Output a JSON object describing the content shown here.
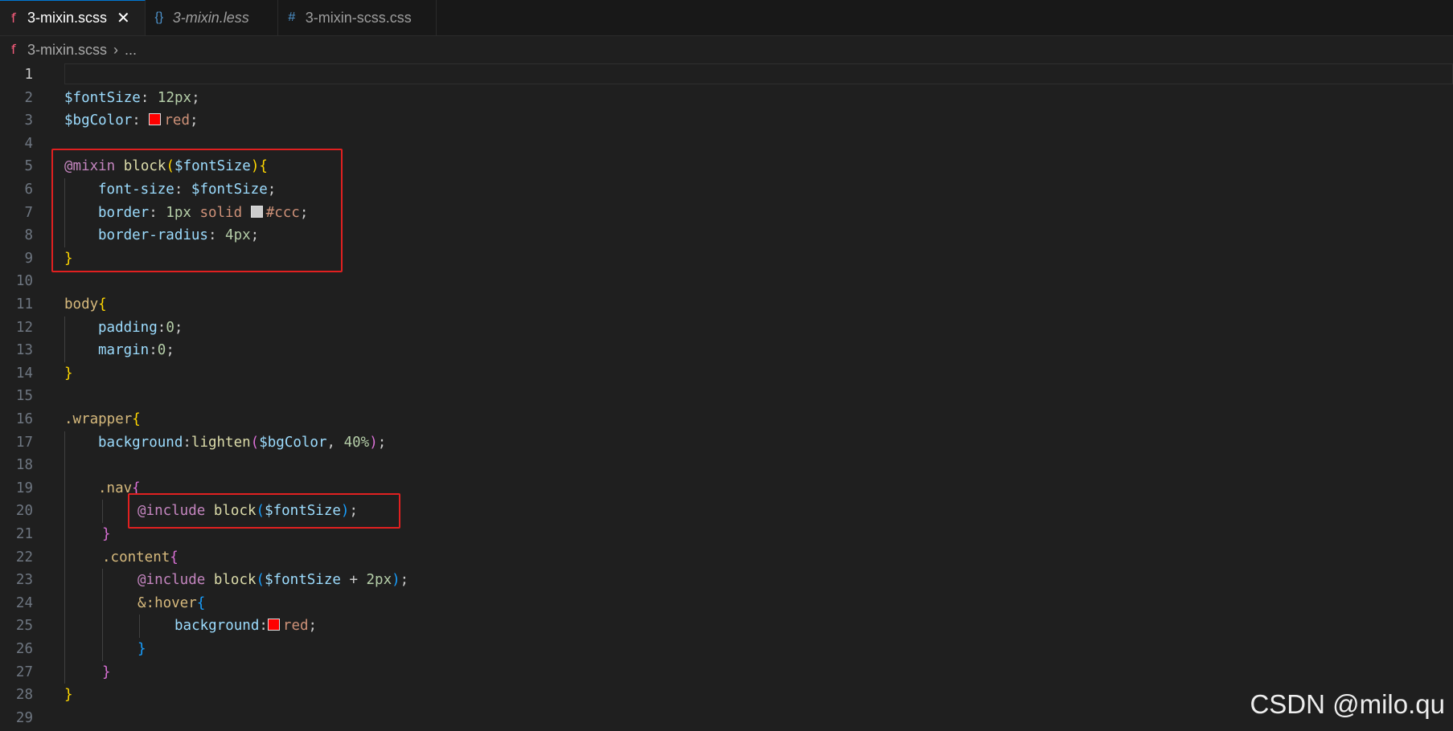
{
  "tabs": [
    {
      "label": "3-mixin.scss",
      "icon": "sass-icon",
      "active": true,
      "close": "✕"
    },
    {
      "label": "3-mixin.less",
      "icon": "braces-icon",
      "active": false
    },
    {
      "label": "3-mixin-scss.css",
      "icon": "hash-icon",
      "active": false
    }
  ],
  "icons": {
    "sass": "ẝ",
    "braces": "{}",
    "hash": "#"
  },
  "breadcrumb": {
    "file": "3-mixin.scss",
    "separator": "›",
    "more": "..."
  },
  "line_numbers": [
    "1",
    "2",
    "3",
    "4",
    "5",
    "6",
    "7",
    "8",
    "9",
    "10",
    "11",
    "12",
    "13",
    "14",
    "15",
    "16",
    "17",
    "18",
    "19",
    "20",
    "21",
    "22",
    "23",
    "24",
    "25",
    "26",
    "27",
    "28",
    "29"
  ],
  "colors": {
    "red": "#ff0000",
    "ccc": "#cccccc",
    "highlight": "#e02020"
  },
  "code": {
    "l2": {
      "var": "$fontSize",
      "colon": ": ",
      "val": "12px",
      "end": ";"
    },
    "l3": {
      "var": "$bgColor",
      "colon": ": ",
      "val": "red",
      "end": ";"
    },
    "l5": {
      "kw": "@mixin",
      "sp": " ",
      "fn": "block",
      "open": "(",
      "arg": "$fontSize",
      "close": ")",
      "brace": "{"
    },
    "l6": {
      "prop": "font-size",
      "colon": ": ",
      "val": "$fontSize",
      "end": ";"
    },
    "l7": {
      "prop": "border",
      "colon": ": ",
      "n": "1px",
      "sp": " ",
      "solid": "solid",
      "sp2": " ",
      "color": "#ccc",
      "end": ";"
    },
    "l8": {
      "prop": "border-radius",
      "colon": ": ",
      "val": "4px",
      "end": ";"
    },
    "l9": {
      "brace": "}"
    },
    "l11": {
      "sel": "body",
      "brace": "{"
    },
    "l12": {
      "prop": "padding",
      "colon": ":",
      "val": "0",
      "end": ";"
    },
    "l13": {
      "prop": "margin",
      "colon": ":",
      "val": "0",
      "end": ";"
    },
    "l14": {
      "brace": "}"
    },
    "l16": {
      "sel": ".wrapper",
      "brace": "{"
    },
    "l17": {
      "prop": "background",
      "colon": ":",
      "fn": "lighten",
      "open": "(",
      "arg": "$bgColor",
      "comma": ", ",
      "num": "40%",
      "close": ")",
      "end": ";"
    },
    "l19": {
      "sel": ".nav",
      "brace": "{"
    },
    "l20": {
      "kw": "@include",
      "sp": " ",
      "fn": "block",
      "open": "(",
      "arg": "$fontSize",
      "close": ")",
      "end": ";"
    },
    "l21": {
      "brace": "}"
    },
    "l22": {
      "sel": ".content",
      "brace": "{"
    },
    "l23": {
      "kw": "@include",
      "sp": " ",
      "fn": "block",
      "open": "(",
      "arg": "$fontSize",
      "op": " + ",
      "num": "2px",
      "close": ")",
      "end": ";"
    },
    "l24": {
      "sel": "&:hover",
      "brace": "{"
    },
    "l25": {
      "prop": "background",
      "colon": ":",
      "val": "red",
      "end": ";"
    },
    "l26": {
      "brace": "}"
    },
    "l27": {
      "brace": "}"
    },
    "l28": {
      "brace": "}"
    }
  },
  "watermark": "CSDN @milo.qu"
}
